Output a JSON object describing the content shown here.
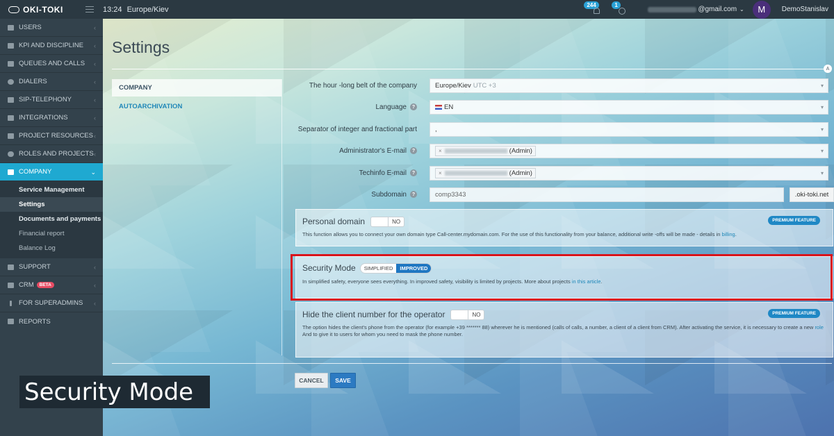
{
  "topbar": {
    "brand": "OKI-TOKI",
    "time": "13:24",
    "timezone": "Europe/Kiev",
    "notifications_count": "244",
    "tasks_count": "1",
    "email_suffix": "@gmail.com",
    "avatar_letter": "M",
    "username": "DemoStanislav"
  },
  "sidebar": {
    "items": [
      {
        "label": "USERS",
        "icon": "user-icon"
      },
      {
        "label": "KPI AND DISCIPLINE",
        "icon": "check-icon"
      },
      {
        "label": "QUEUES AND CALLS",
        "icon": "list-icon"
      },
      {
        "label": "DIALERS",
        "icon": "clock-icon"
      },
      {
        "label": "SIP-TELEPHONY",
        "icon": "phone-icon"
      },
      {
        "label": "INTEGRATIONS",
        "icon": "gears-icon"
      },
      {
        "label": "PROJECT RESOURCES",
        "icon": "folder-icon"
      },
      {
        "label": "ROLES AND PROJECTS",
        "icon": "toggle-icon"
      },
      {
        "label": "COMPANY",
        "icon": "chart-icon"
      }
    ],
    "company_sub": [
      "Service Management",
      "Settings",
      "Documents and payments",
      "Financial report",
      "Balance Log"
    ],
    "bottom_items": [
      {
        "label": "SUPPORT",
        "icon": "wrench-icon"
      },
      {
        "label": "CRM",
        "icon": "crm-icon",
        "badge": "BETA"
      },
      {
        "label": "FOR SUPERADMINS",
        "icon": "exclamation-icon"
      },
      {
        "label": "REPORTS",
        "icon": "line-chart-icon"
      }
    ]
  },
  "page": {
    "title": "Settings",
    "collapse_marker": "A",
    "tabs": [
      "COMPANY",
      "AUTOARCHIVATION"
    ]
  },
  "form": {
    "timezone_label": "The hour -long belt of the company",
    "timezone_value": "Europe/Kiev",
    "timezone_offset": "UTC +3",
    "language_label": "Language",
    "language_value": "EN",
    "separator_label": "Separator of integer and fractional part",
    "separator_value": ",",
    "admin_email_label": "Administrator's E-mail",
    "admin_email_role": "(Admin)",
    "techinfo_label": "Techinfo E-mail",
    "techinfo_role": "(Admin)",
    "subdomain_label": "Subdomain",
    "subdomain_value": "comp3343",
    "subdomain_suffix": ".oki-toki.net"
  },
  "personal_domain": {
    "title": "Personal domain",
    "toggle": "NO",
    "badge": "PREMIUM FEATURE",
    "desc": "This function allows you to connect your own domain type Call-center.mydomain.com. For the use of this functionality from your balance, additional write -offs will be made - details in",
    "link": "billing",
    "desc_end": "."
  },
  "security_mode": {
    "title": "Security Mode",
    "option_a": "SIMPLIFIED",
    "option_b": "IMPROVED",
    "desc": "In simplified safety, everyone sees everything. In improved safety, visibility is limited by projects. More about projects",
    "link": "in this article",
    "desc_end": "."
  },
  "hide_number": {
    "title": "Hide the client number for the operator",
    "toggle": "NO",
    "badge": "PREMIUM FEATURE",
    "desc_a": "The option hides the client's phone from the operator (for example +39 ******* 88) wherever he is mentioned (calls of calls, a number, a client of a client from CRM). After activating the service, it is necessary to create a new",
    "link": "role",
    "desc_b": "And to give it to users for whom you need to mask the phone number."
  },
  "actions": {
    "cancel": "CANCEL",
    "save": "SAVE"
  },
  "overlay_caption": "Security Mode",
  "colors": {
    "accent": "#1fa9d1",
    "highlight_frame": "#d9141b",
    "primary_button": "#2c7ac2"
  }
}
